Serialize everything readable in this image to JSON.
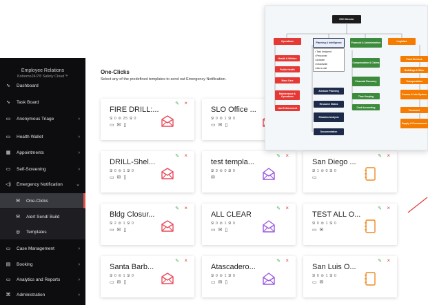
{
  "sidebar": {
    "org_title": "Employee Relations",
    "org_subtitle": "Kohomo24/7® Safety Cloud™",
    "items": [
      {
        "label": "Dashboard",
        "icon": "∿"
      },
      {
        "label": "Task Board",
        "icon": "∿"
      },
      {
        "label": "Anonymous Triage",
        "icon": "▭"
      },
      {
        "label": "Health Wallet",
        "icon": "▭"
      },
      {
        "label": "Appointments",
        "icon": "▦"
      },
      {
        "label": "Self-Screening",
        "icon": "▭"
      },
      {
        "label": "Emergency Notification",
        "icon": "◁)"
      },
      {
        "label": "One-Clicks",
        "icon": "✉"
      },
      {
        "label": "Alert Send/ Build",
        "icon": "✉"
      },
      {
        "label": "Templates",
        "icon": "◎"
      },
      {
        "label": "Case Management",
        "icon": "▭"
      },
      {
        "label": "Booking",
        "icon": "▤"
      },
      {
        "label": "Analytics and Reports",
        "icon": "▭"
      },
      {
        "label": "Administration",
        "icon": "⌘"
      }
    ]
  },
  "main": {
    "title": "One-Clicks",
    "description": "Select any of the predefined templates to send out Emergency Notification."
  },
  "cards": [
    {
      "name": "FIRE DRILL:...",
      "counts": "Ջ 0  ⊜ 25  Ջ 0",
      "channels": "▭ ✉ ▯",
      "icon": "mail-icon",
      "color": "#e94b5a"
    },
    {
      "name": "SLO Office ...",
      "counts": "Ջ 0  ⊜ 1  Ջ 0",
      "channels": "▭ ✉ ▯",
      "icon": "mail-icon",
      "color": "#e94b5a"
    },
    {
      "name": "DRILL-Shel...",
      "counts": "Ջ 0  ⊜ 1  Ջ 0",
      "channels": "▭ ✉ ▯",
      "icon": "mail-icon",
      "color": "#e94b5a"
    },
    {
      "name": "test templa...",
      "counts": "Ջ 3  ⊜ 0  Ջ 0",
      "channels": "✉",
      "icon": "mail-open-icon",
      "color": "#9b59e0"
    },
    {
      "name": "San Diego ...",
      "counts": "Ջ 1  ⊜ 0  Ջ 0",
      "channels": "▭",
      "icon": "notebook-icon",
      "color": "#f08a24"
    },
    {
      "name": "Bldg Closur...",
      "counts": "Ջ 2  ⊜ 1  Ջ 0",
      "channels": "▭ ✉ ▯",
      "icon": "mail-icon",
      "color": "#e94b5a"
    },
    {
      "name": "ALL CLEAR",
      "counts": "Ջ 0  ⊜ 1  Ջ 0",
      "channels": "▭ ✉ ▯",
      "icon": "mail-open-icon",
      "color": "#9b59e0"
    },
    {
      "name": "TEST ALL O...",
      "counts": "Ջ 0  ⊜ 1  Ջ 0",
      "channels": "▭ ✉",
      "icon": "notebook-icon",
      "color": "#f08a24"
    },
    {
      "name": "Santa Barb...",
      "counts": "Ջ 0  ⊜ 1  Ջ 0",
      "channels": "▭ ✉ ▯",
      "icon": "mail-icon",
      "color": "#e94b5a"
    },
    {
      "name": "Atascadero...",
      "counts": "Ջ 0  ⊜ 1  Ջ 0",
      "channels": "▭ ✉ ▯",
      "icon": "mail-open-icon",
      "color": "#9b59e0"
    },
    {
      "name": "San Luis O...",
      "counts": "Ջ 0  ⊜ 1  Ջ 0",
      "channels": "▭ ✉",
      "icon": "notebook-icon",
      "color": "#f08a24"
    }
  ],
  "card_actions": {
    "edit": "✎",
    "delete": "×"
  },
  "org_chart": {
    "root": "EOC Director",
    "sections": {
      "operations": "Operations",
      "planning": "Planning & Intelligence",
      "finance": "Financial & Administration",
      "logistics": "Logistics"
    },
    "operations_items": [
      "Health & Welfare",
      "Public Health",
      "Mass Care",
      "Maintenance & Operations",
      "Law Enforcement"
    ],
    "planning_list": [
      "Task Assigned",
      "Personnel",
      "Activate",
      "Deactivate",
      "Add a unit"
    ],
    "planning_items": [
      "Advance Planning",
      "Resource Status",
      "Situation Analysis",
      "Documentation"
    ],
    "finance_items": [
      "Compensation & Claims",
      "Financial Recovery",
      "Time Keeping",
      "Cost Accounting"
    ],
    "logistics_items": [
      "Food Services",
      "Buildings & Sites",
      "Transportation",
      "Comms & Info System",
      "Personnel",
      "Supply & Procurement"
    ]
  }
}
